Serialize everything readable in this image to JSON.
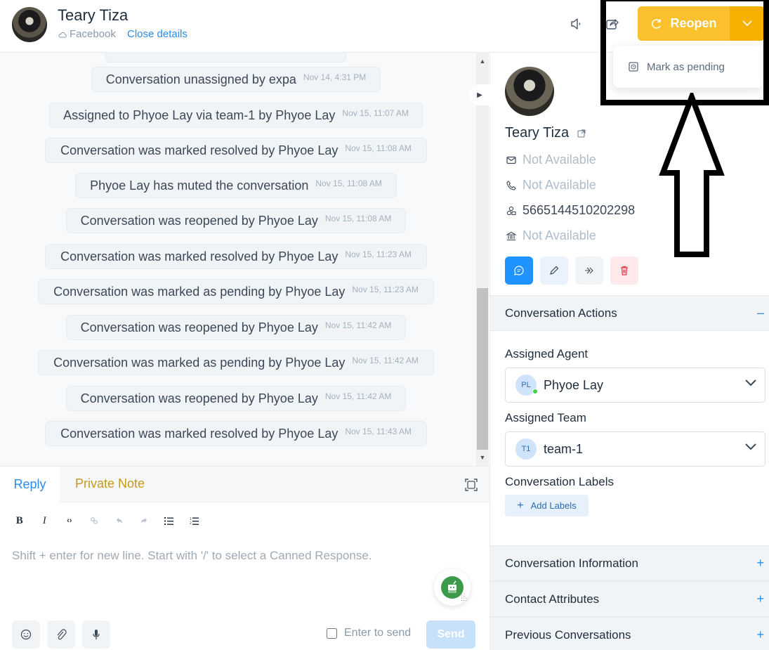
{
  "header": {
    "contact_name": "Teary Tiza",
    "channel": "Facebook",
    "close_details": "Close details",
    "reopen_label": "Reopen",
    "dropdown_items": [
      {
        "label": "Mark as pending",
        "icon": "snooze-icon"
      }
    ]
  },
  "messages": [
    {
      "text": "",
      "timestamp": ""
    },
    {
      "text": "Conversation unassigned by expa",
      "timestamp": "Nov 14, 4:31 PM"
    },
    {
      "text": "Assigned to Phyoe Lay via team-1 by Phyoe Lay",
      "timestamp": "Nov 15, 11:07 AM"
    },
    {
      "text": "Conversation was marked resolved by Phyoe Lay",
      "timestamp": "Nov 15, 11:08 AM"
    },
    {
      "text": "Phyoe Lay has muted the conversation",
      "timestamp": "Nov 15, 11:08 AM"
    },
    {
      "text": "Conversation was reopened by Phyoe Lay",
      "timestamp": "Nov 15, 11:08 AM"
    },
    {
      "text": "Conversation was marked resolved by Phyoe Lay",
      "timestamp": "Nov 15, 11:23 AM"
    },
    {
      "text": "Conversation was marked as pending by Phyoe Lay",
      "timestamp": "Nov 15, 11:23 AM"
    },
    {
      "text": "Conversation was reopened by Phyoe Lay",
      "timestamp": "Nov 15, 11:42 AM"
    },
    {
      "text": "Conversation was marked as pending by Phyoe Lay",
      "timestamp": "Nov 15, 11:42 AM"
    },
    {
      "text": "Conversation was reopened by Phyoe Lay",
      "timestamp": "Nov 15, 11:42 AM"
    },
    {
      "text": "Conversation was marked resolved by Phyoe Lay",
      "timestamp": "Nov 15, 11:43 AM"
    }
  ],
  "reply": {
    "tabs": [
      "Reply",
      "Private Note"
    ],
    "active_tab": "Reply",
    "toolbar": [
      "B",
      "I",
      "<>",
      "link",
      "undo",
      "redo",
      "bullet-list",
      "ordered-list"
    ],
    "placeholder": "Shift + enter for new line. Start with '/' to select a Canned Response.",
    "enter_to_send_label": "Enter to send",
    "enter_to_send_checked": false,
    "send_label": "Send"
  },
  "contact": {
    "name": "Teary Tiza",
    "email": "Not Available",
    "phone": "Not Available",
    "identifier": "5665144510202298",
    "company": "Not Available"
  },
  "sections": {
    "conversation_actions": {
      "title": "Conversation Actions",
      "expanded": true,
      "assigned_agent_label": "Assigned Agent",
      "assigned_agent": {
        "initials": "PL",
        "name": "Phyoe Lay",
        "online": true
      },
      "assigned_team_label": "Assigned Team",
      "assigned_team": {
        "initials": "T1",
        "name": "team-1"
      },
      "labels_title": "Conversation Labels",
      "add_labels": "Add Labels"
    },
    "collapsed": [
      {
        "title": "Conversation Information"
      },
      {
        "title": "Contact Attributes"
      },
      {
        "title": "Previous Conversations"
      }
    ]
  },
  "colors": {
    "primary": "#1f93ff",
    "reopen": "#fbc02d",
    "reopen_dropdown": "#f5b000",
    "private_note": "#c7981e",
    "danger": "#e0344b"
  }
}
